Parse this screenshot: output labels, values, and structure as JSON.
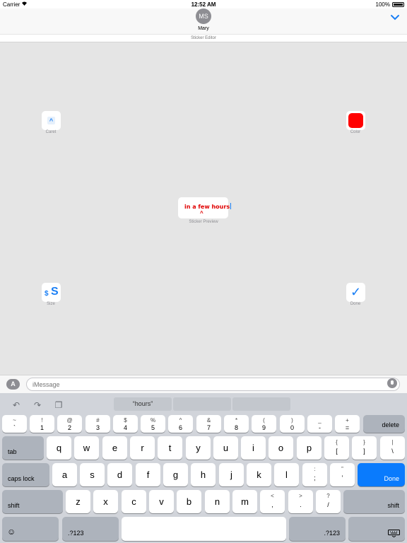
{
  "status_bar": {
    "carrier": "Carrier",
    "wifi_icon": "wifi-icon",
    "time": "12:52 AM",
    "battery": "100%"
  },
  "header": {
    "avatar_initials": "MS",
    "contact_name": "Mary",
    "collapse_icon": "chevron-down-icon",
    "subtitle": "Sticker Editor"
  },
  "editor": {
    "caret_label": "Caret",
    "color_label": "Color",
    "color_value": "#ff0000",
    "preview_text": "in a few hours",
    "preview_caret": "^",
    "preview_label": "Sticker Preview",
    "size_label": "Size",
    "size_icon_small": "$",
    "size_icon_big": "S",
    "done_label": "Done",
    "done_icon": "✓",
    "caret_icon": "^"
  },
  "message_bar": {
    "placeholder": "iMessage",
    "app_icon": "appstore-icon",
    "mic_icon": "microphone-icon"
  },
  "keyboard": {
    "suggestions": [
      "“hours”",
      "",
      ""
    ],
    "row1": [
      {
        "top": "~",
        "bottom": "`"
      },
      {
        "top": "!",
        "bottom": "1"
      },
      {
        "top": "@",
        "bottom": "2"
      },
      {
        "top": "#",
        "bottom": "3"
      },
      {
        "top": "$",
        "bottom": "4"
      },
      {
        "top": "%",
        "bottom": "5"
      },
      {
        "top": "^",
        "bottom": "6"
      },
      {
        "top": "&",
        "bottom": "7"
      },
      {
        "top": "*",
        "bottom": "8"
      },
      {
        "top": "(",
        "bottom": "9"
      },
      {
        "top": ")",
        "bottom": "0"
      },
      {
        "top": "_",
        "bottom": "-"
      },
      {
        "top": "+",
        "bottom": "="
      }
    ],
    "delete": "delete",
    "tab": "tab",
    "row2": [
      "q",
      "w",
      "e",
      "r",
      "t",
      "y",
      "u",
      "i",
      "o",
      "p"
    ],
    "row2_extra": [
      {
        "top": "{",
        "bottom": "["
      },
      {
        "top": "}",
        "bottom": "]"
      },
      {
        "top": "|",
        "bottom": "\\"
      }
    ],
    "caps_lock": "caps lock",
    "row3": [
      "a",
      "s",
      "d",
      "f",
      "g",
      "h",
      "j",
      "k",
      "l"
    ],
    "row3_extra": [
      {
        "top": ":",
        "bottom": ";"
      },
      {
        "top": "”",
        "bottom": "’"
      }
    ],
    "done": "Done",
    "shift": "shift",
    "row4": [
      "z",
      "x",
      "c",
      "v",
      "b",
      "n",
      "m"
    ],
    "row4_extra": [
      {
        "top": "<",
        "bottom": ","
      },
      {
        "top": ">",
        "bottom": "."
      },
      {
        "top": "?",
        "bottom": "/"
      }
    ],
    "emoji": "☺",
    "numbers": ".?123",
    "space": ""
  }
}
